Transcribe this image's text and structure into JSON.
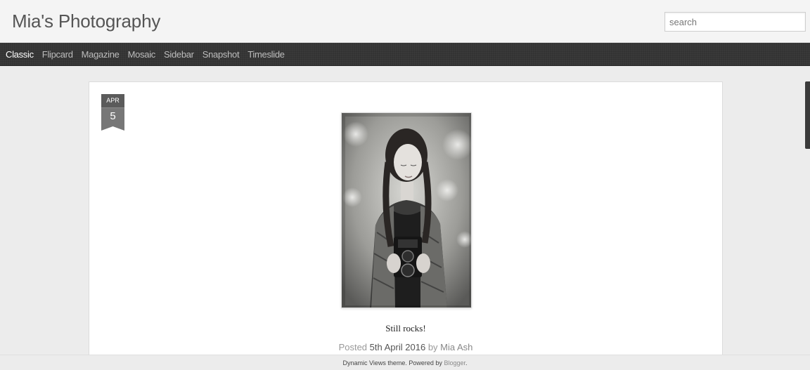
{
  "blog": {
    "title": "Mia's Photography"
  },
  "search": {
    "placeholder": "search"
  },
  "nav": {
    "items": [
      "Classic",
      "Flipcard",
      "Magazine",
      "Mosaic",
      "Sidebar",
      "Snapshot",
      "Timeslide"
    ],
    "active_index": 0
  },
  "post": {
    "date": {
      "month": "APR",
      "day": "5"
    },
    "caption": "Still rocks!",
    "meta": {
      "posted_label": "Posted",
      "date": "5th April 2016",
      "by_label": "by",
      "author": "Mia Ash"
    }
  },
  "footer": {
    "text": "Dynamic Views theme. Powered by",
    "link": "Blogger",
    "end": "."
  },
  "colors": {
    "navbar_bg": "#333333",
    "nav_active": "#ffffff",
    "nav_inactive": "#bdbdbd",
    "badge_month": "#5b5b5b",
    "badge_day": "#777777"
  }
}
